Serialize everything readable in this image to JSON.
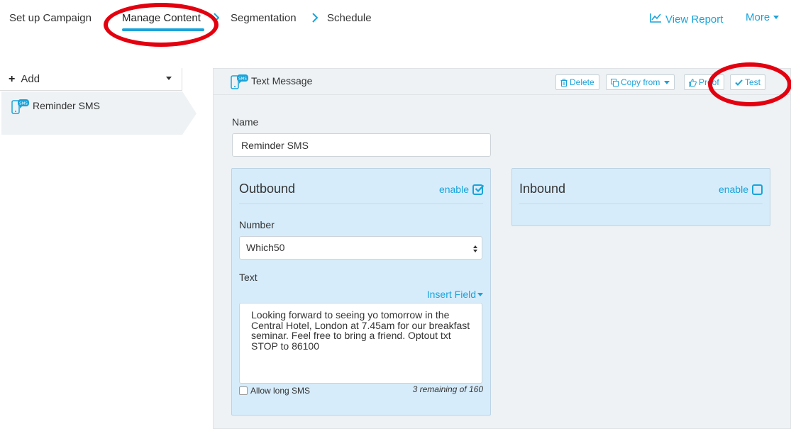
{
  "steps": [
    {
      "label": "Set up Campaign"
    },
    {
      "label": "Manage Content"
    },
    {
      "label": "Segmentation"
    },
    {
      "label": "Schedule"
    }
  ],
  "header_links": {
    "view_report": "View Report",
    "more": "More"
  },
  "sidebar": {
    "add_label": "Add",
    "items": [
      {
        "label": "Reminder SMS"
      }
    ]
  },
  "panel": {
    "title": "Text Message",
    "buttons": {
      "delete": "Delete",
      "copy_from": "Copy from",
      "proof": "Proof",
      "test": "Test"
    },
    "name_label": "Name",
    "name_value": "Reminder SMS",
    "outbound": {
      "title": "Outbound",
      "enable_label": "enable",
      "enabled": true,
      "number_label": "Number",
      "number_value": "Which50",
      "text_label": "Text",
      "insert_field": "Insert Field",
      "text_value": "Looking forward to seeing yo tomorrow in the Central Hotel, London at 7.45am for our breakfast seminar. Feel free to bring a friend. Optout txt STOP to 86100",
      "allow_long_sms": "Allow long SMS",
      "remaining": "3 remaining of 160"
    },
    "inbound": {
      "title": "Inbound",
      "enable_label": "enable",
      "enabled": false
    }
  },
  "colors": {
    "accent": "#1aa3d9",
    "annotation": "#e3000f",
    "panel_bg": "#eef2f5",
    "box_bg": "#d7ecfa"
  }
}
